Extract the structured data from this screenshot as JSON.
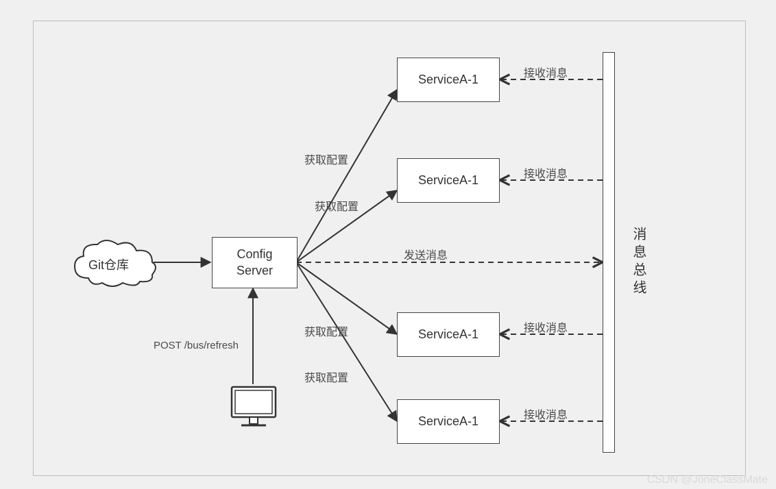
{
  "nodes": {
    "git": "Git仓库",
    "config_server": "Config\nServer",
    "service1": "ServiceA-1",
    "service2": "ServiceA-1",
    "service3": "ServiceA-1",
    "service4": "ServiceA-1",
    "bus": "消息总线"
  },
  "edges": {
    "get_config": "获取配置",
    "send_msg": "发送消息",
    "recv_msg": "接收消息",
    "post_refresh": "POST /bus/refresh"
  },
  "watermark": "CSDN @JoneClassMate"
}
